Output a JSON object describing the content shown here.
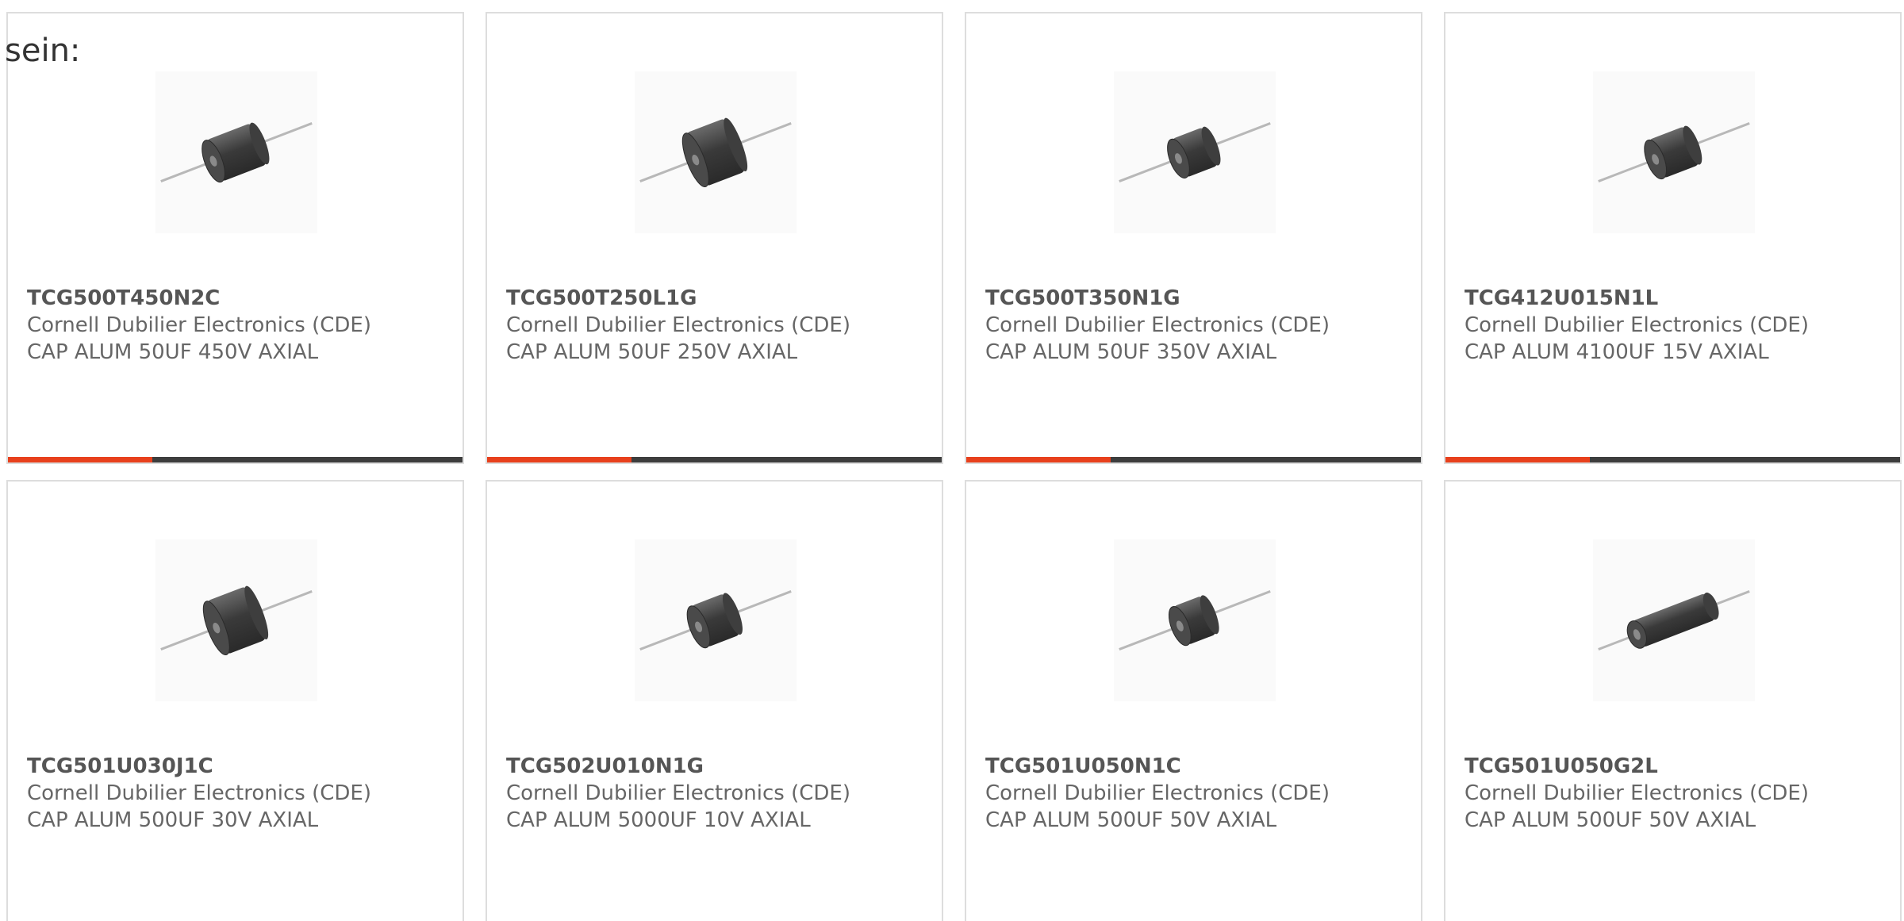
{
  "intro_text": "sein:",
  "colors": {
    "accent": "#e8401c",
    "bar": "#3d3d3d",
    "border": "#dddddd"
  },
  "products": [
    {
      "part": "TCG500T450N2C",
      "manufacturer": "Cornell Dubilier Electronics (CDE)",
      "description": "CAP ALUM 50UF 450V AXIAL",
      "icon": "axial-capacitor-icon"
    },
    {
      "part": "TCG500T250L1G",
      "manufacturer": "Cornell Dubilier Electronics (CDE)",
      "description": "CAP ALUM 50UF 250V AXIAL",
      "icon": "axial-capacitor-icon"
    },
    {
      "part": "TCG500T350N1G",
      "manufacturer": "Cornell Dubilier Electronics (CDE)",
      "description": "CAP ALUM 50UF 350V AXIAL",
      "icon": "axial-capacitor-icon"
    },
    {
      "part": "TCG412U015N1L",
      "manufacturer": "Cornell Dubilier Electronics (CDE)",
      "description": "CAP ALUM 4100UF 15V AXIAL",
      "icon": "axial-capacitor-icon"
    },
    {
      "part": "TCG501U030J1C",
      "manufacturer": "Cornell Dubilier Electronics (CDE)",
      "description": "CAP ALUM 500UF 30V AXIAL",
      "icon": "axial-capacitor-icon"
    },
    {
      "part": "TCG502U010N1G",
      "manufacturer": "Cornell Dubilier Electronics (CDE)",
      "description": "CAP ALUM 5000UF 10V AXIAL",
      "icon": "axial-capacitor-icon"
    },
    {
      "part": "TCG501U050N1C",
      "manufacturer": "Cornell Dubilier Electronics (CDE)",
      "description": "CAP ALUM 500UF 50V AXIAL",
      "icon": "axial-capacitor-icon"
    },
    {
      "part": "TCG501U050G2L",
      "manufacturer": "Cornell Dubilier Electronics (CDE)",
      "description": "CAP ALUM 500UF 50V AXIAL",
      "icon": "axial-capacitor-icon"
    }
  ]
}
